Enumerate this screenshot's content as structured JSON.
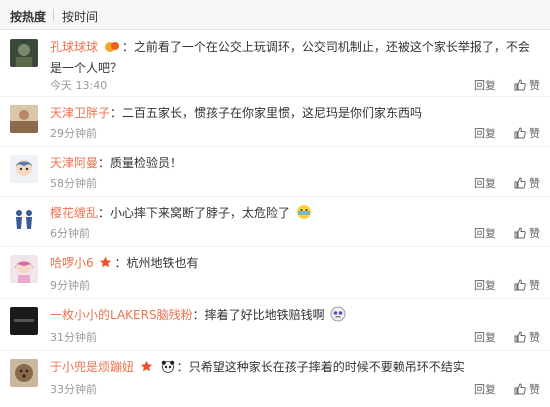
{
  "sort": {
    "hot": "按热度",
    "time": "按时间"
  },
  "comments": [
    {
      "user": "孔球球球",
      "text": "之前看了一个在公交上玩调环，公交司机制止，还被这个家长举报了，不会是一个人吧？",
      "time": "今天 13:40",
      "reply": "回复",
      "like": "赞"
    },
    {
      "user": "天津卫胖子",
      "text": "二百五家长，惯孩子在你家里惯，这尼玛是你们家东西吗",
      "time": "29分钟前",
      "reply": "回复",
      "like": "赞"
    },
    {
      "user": "天津阿曼",
      "text": "质量检验员！",
      "time": "58分钟前",
      "reply": "回复",
      "like": "赞"
    },
    {
      "user": "樱花缠乱",
      "text": "小心摔下来窝断了脖子，太危险了",
      "time": "6分钟前",
      "reply": "回复",
      "like": "赞"
    },
    {
      "user": "哈啰小6",
      "text": "杭州地铁也有",
      "time": "9分钟前",
      "reply": "回复",
      "like": "赞"
    },
    {
      "user": "一枚小小的LAKERS脑残粉",
      "text": "摔着了好比地铁赔钱啊",
      "time": "31分钟前",
      "reply": "回复",
      "like": "赞"
    },
    {
      "user": "于小兜是烦蹦妞",
      "text": "只希望这种家长在孩子摔着的时候不要赖吊环不结实",
      "time": "33分钟前",
      "reply": "回复",
      "like": "赞"
    }
  ],
  "colors": {
    "username": "#eb7350",
    "time": "#999999",
    "sortbar_bg": "#f6f6f6"
  }
}
